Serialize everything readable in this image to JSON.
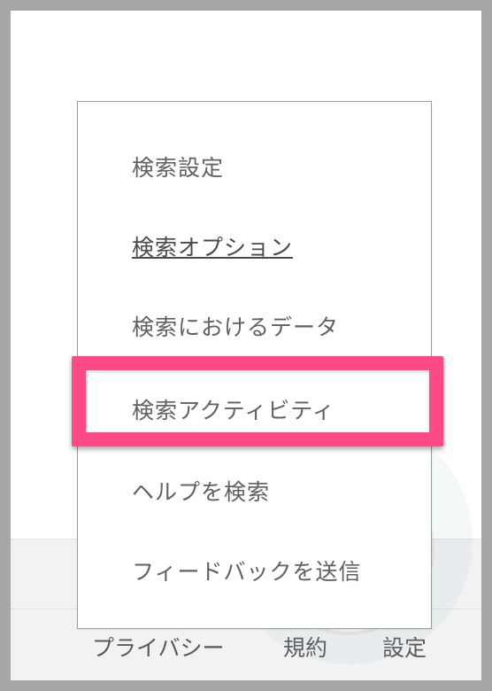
{
  "menu": {
    "items": [
      {
        "label": "検索設定"
      },
      {
        "label": "検索オプション"
      },
      {
        "label": "検索におけるデータ"
      },
      {
        "label": "検索アクティビティ"
      },
      {
        "label": "ヘルプを検索"
      },
      {
        "label": "フィードバックを送信"
      }
    ]
  },
  "footer": {
    "privacy": "プライバシー",
    "terms": "規約",
    "settings": "設定"
  },
  "annotation": {
    "highlight_color": "#ff4a85"
  }
}
